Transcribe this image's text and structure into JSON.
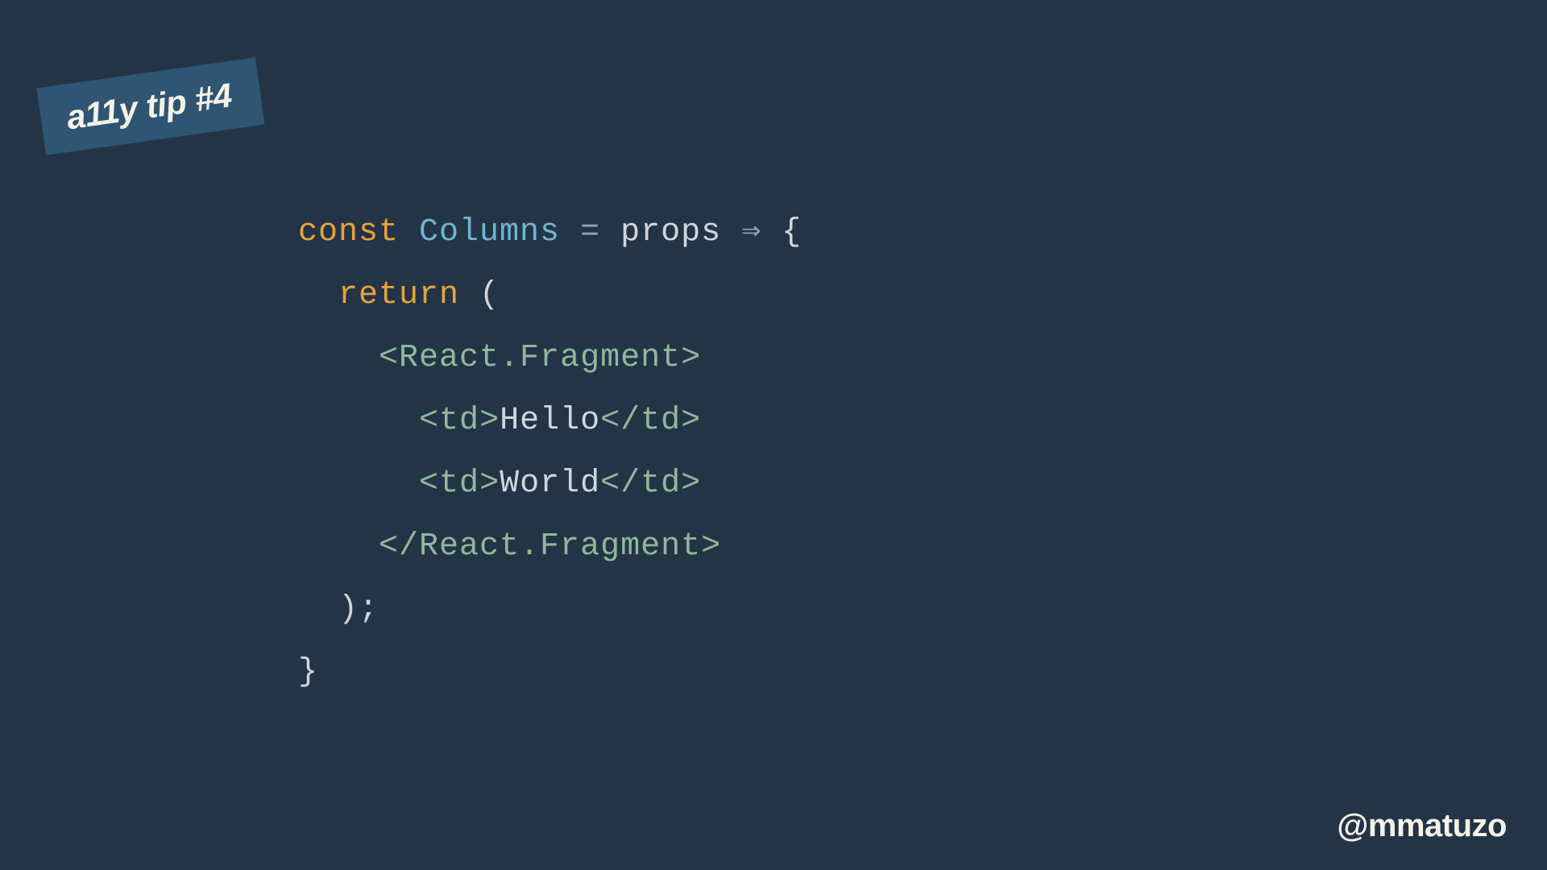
{
  "badge": {
    "label": "a11y tip #4"
  },
  "code": {
    "line1": {
      "kw": "const ",
      "ident": "Columns ",
      "op1": "= ",
      "plain1": "props ",
      "arrow": "⇒ ",
      "brace": "{"
    },
    "line2": {
      "indent": "  ",
      "kw": "return ",
      "paren": "("
    },
    "line3": {
      "indent": "    ",
      "lt": "<",
      "name": "React.Fragment",
      "gt": ">"
    },
    "line4": {
      "indent": "      ",
      "lt1": "<",
      "name1": "td",
      "gt1": ">",
      "text": "Hello",
      "lt2": "</",
      "name2": "td",
      "gt2": ">"
    },
    "line5": {
      "indent": "      ",
      "lt1": "<",
      "name1": "td",
      "gt1": ">",
      "text": "World",
      "lt2": "</",
      "name2": "td",
      "gt2": ">"
    },
    "line6": {
      "indent": "    ",
      "lt": "</",
      "name": "React.Fragment",
      "gt": ">"
    },
    "line7": {
      "indent": "  ",
      "close": ");"
    },
    "line8": {
      "brace": "}"
    }
  },
  "footer": {
    "handle": "@mmatuzo"
  },
  "colors": {
    "bg": "#243447",
    "badgeBg": "#2f5573",
    "keyword": "#e6a43c",
    "identifier": "#6fb6cf",
    "tag": "#8fb99a",
    "text": "#d0d6dc",
    "cream": "#f5f2e8"
  }
}
